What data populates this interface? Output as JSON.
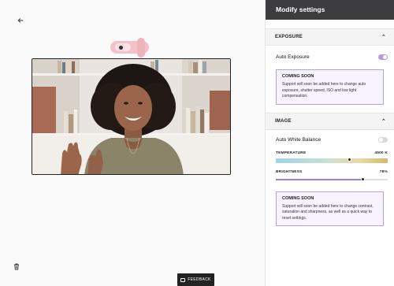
{
  "canvas": {
    "back_icon": "arrow-left-icon",
    "delete_icon": "trash-icon",
    "feedback": {
      "label": "FEEDBACK",
      "icon": "message-icon"
    }
  },
  "panel": {
    "title": "Modify settings",
    "exposure": {
      "heading": "EXPOSURE",
      "chevron": "⌃",
      "auto_exposure": {
        "label": "Auto Exposure",
        "enabled": true
      },
      "notice": {
        "title": "COMING SOON",
        "text": "Support will soon be added here to change auto exposure, shutter speed, ISO and low light compensation."
      }
    },
    "image": {
      "heading": "IMAGE",
      "chevron": "⌃",
      "auto_white_balance": {
        "label": "Auto White Balance",
        "enabled": false
      },
      "temperature": {
        "label": "TEMPERATURE",
        "value": "4500 K",
        "level": 0.66
      },
      "brightness": {
        "label": "BRIGHTNESS",
        "value": "78%",
        "level": 0.78
      },
      "notice": {
        "title": "COMING SOON",
        "text": "Support will soon be added here to change contrast, saturation and sharpness, as well as a quick way to reset settings."
      }
    }
  },
  "colors": {
    "accent": "#b49ce6",
    "accent_border": "#b59de8",
    "callout_bg": "#f7f3ff",
    "header_bg": "#3c3c3e",
    "webcam_pink": "#f2c2c8"
  }
}
